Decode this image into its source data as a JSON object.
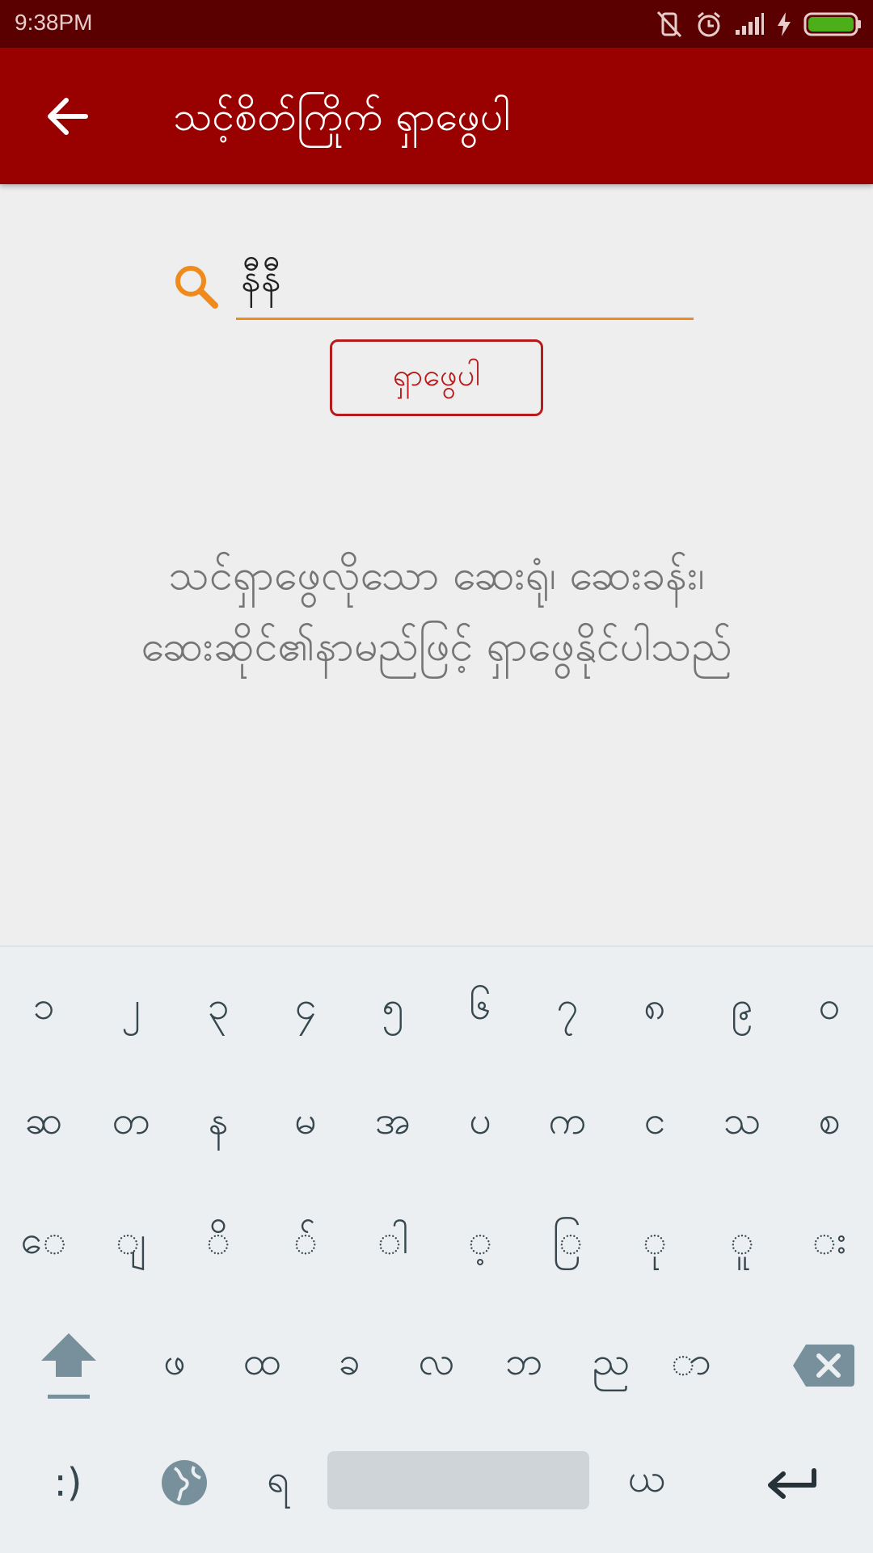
{
  "status_bar": {
    "time": "9:38PM",
    "icons": [
      "vibrate-off-icon",
      "alarm-icon",
      "signal-icon",
      "charging-icon",
      "battery-icon"
    ],
    "battery_color": "#4caf1a"
  },
  "app_bar": {
    "title": "သင့်စိတ်ကြိုက် ရှာဖွေပါ",
    "back_icon": "arrow-left-icon",
    "color": "#990000"
  },
  "search": {
    "value": "နီနီ",
    "button_label": "ရှာဖွေပါ",
    "accent": "#f08a1c"
  },
  "hint": {
    "line1": "သင်ရှာဖွေလိုသော ဆေးရုံ၊ ဆေးခန်း၊",
    "line2": "ဆေးဆိုင်၏နာမည်ဖြင့် ရှာဖွေနိုင်ပါသည်"
  },
  "keyboard": {
    "row1": [
      "၁",
      "၂",
      "၃",
      "၄",
      "၅",
      "၆",
      "၇",
      "၈",
      "၉",
      "၀"
    ],
    "row2": [
      "ဆ",
      "တ",
      "န",
      "မ",
      "အ",
      "ပ",
      "က",
      "င",
      "သ",
      "စ"
    ],
    "row3": [
      "ေ",
      "ျ",
      "ိ",
      "်",
      "ါ",
      "့",
      "ြ",
      "ု",
      "ူ",
      "း"
    ],
    "row4": [
      "ဖ",
      "ထ",
      "ခ",
      "လ",
      "ဘ",
      "ည",
      "ာ"
    ],
    "row5": {
      "emoji": ":)",
      "left_char": "ရ",
      "right_char": "ယ"
    }
  }
}
